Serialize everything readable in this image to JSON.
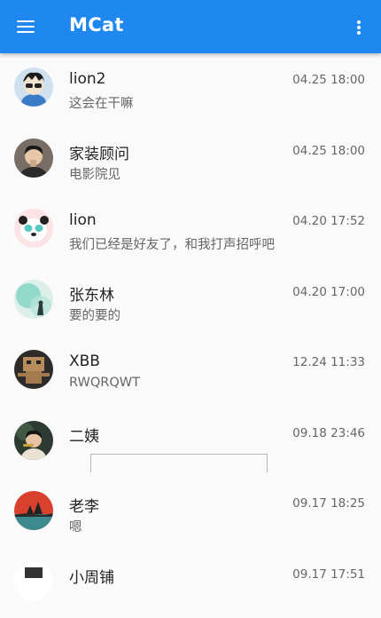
{
  "app": {
    "title": "MCat",
    "colors": {
      "accent": "#1e88f0"
    },
    "icons": {
      "menu": "menu-icon",
      "more": "more-vertical-icon"
    }
  },
  "conversations": [
    {
      "name": "lion2",
      "time": "04.25 18:00",
      "message": "这会在干嘛"
    },
    {
      "name": "家装顾问",
      "time": "04.25 18:00",
      "message": "电影院见"
    },
    {
      "name": "lion",
      "time": "04.20 17:52",
      "message": "我们已经是好友了，和我打声招呼吧"
    },
    {
      "name": "张东林",
      "time": "04.20 17:00",
      "message": "要的要的"
    },
    {
      "name": "XBB",
      "time": "12.24 11:33",
      "message": "RWQRQWT"
    },
    {
      "name": "二姨",
      "time": "09.18 23:46",
      "message": ""
    },
    {
      "name": "老李",
      "time": "09.17 18:25",
      "message": "嗯"
    },
    {
      "name": "小周铺",
      "time": "09.17 17:51",
      "message": ""
    }
  ]
}
